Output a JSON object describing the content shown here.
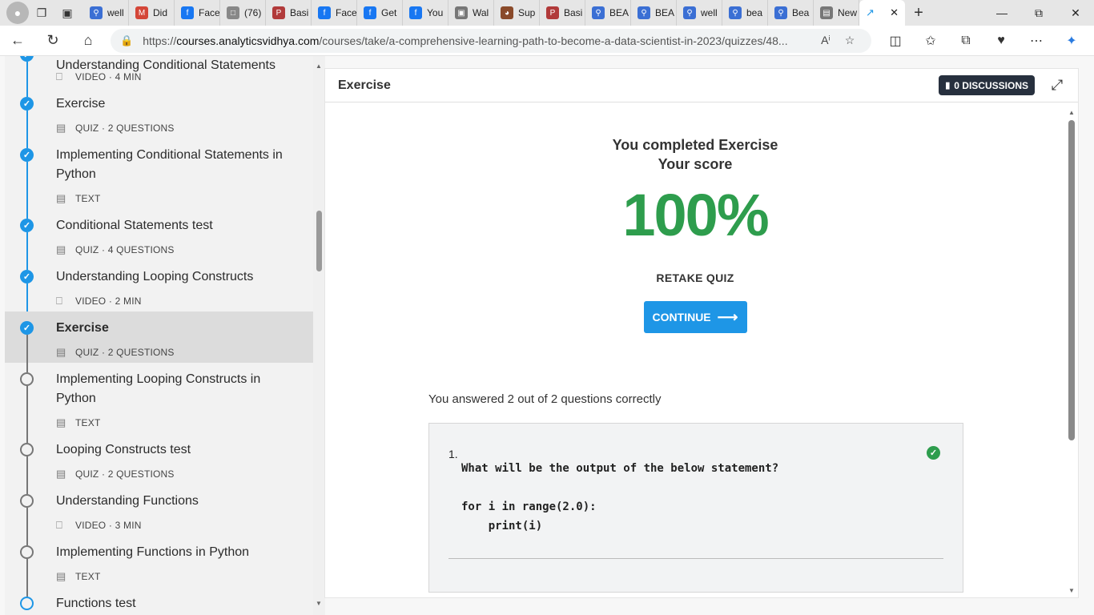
{
  "browser": {
    "tabs": [
      {
        "label": "well",
        "icon": "search-icon",
        "color": "#3b6fd4"
      },
      {
        "label": "Did",
        "icon": "gmail-icon",
        "color": "#d44638"
      },
      {
        "label": "Face",
        "icon": "facebook-icon",
        "color": "#1877f2"
      },
      {
        "label": "(76)",
        "icon": "document-icon",
        "color": "#888888"
      },
      {
        "label": "Basi",
        "icon": "pdf-icon",
        "color": "#b13a3a"
      },
      {
        "label": "Face",
        "icon": "facebook-icon",
        "color": "#1877f2"
      },
      {
        "label": "Get",
        "icon": "facebook-icon",
        "color": "#1877f2"
      },
      {
        "label": "You",
        "icon": "facebook-icon",
        "color": "#1877f2"
      },
      {
        "label": "Wal",
        "icon": "wallet-icon",
        "color": "#777777"
      },
      {
        "label": "Sup",
        "icon": "brand-icon",
        "color": "#8a4a2a"
      },
      {
        "label": "Basi",
        "icon": "pdf-icon",
        "color": "#b13a3a"
      },
      {
        "label": "BEA",
        "icon": "search-icon",
        "color": "#3b6fd4"
      },
      {
        "label": "BEA",
        "icon": "search-icon",
        "color": "#3b6fd4"
      },
      {
        "label": "well",
        "icon": "search-icon",
        "color": "#3b6fd4"
      },
      {
        "label": "bea",
        "icon": "search-icon",
        "color": "#3b6fd4"
      },
      {
        "label": "Bea",
        "icon": "search-icon",
        "color": "#3b6fd4"
      },
      {
        "label": "New",
        "icon": "newtab-icon",
        "color": "#777777"
      }
    ],
    "active_tab_icon": "analytics-icon",
    "url_prefix": "https://",
    "url_host": "courses.analyticsvidhya.com",
    "url_path": "/courses/take/a-comprehensive-learning-path-to-become-a-data-scientist-in-2023/quizzes/48..."
  },
  "sidebar": {
    "items": [
      {
        "title": "Understanding Conditional Statements",
        "meta": "VIDEO · 4 MIN",
        "type": "video",
        "status": "done"
      },
      {
        "title": "Exercise",
        "meta": "QUIZ · 2 QUESTIONS",
        "type": "quiz",
        "status": "done"
      },
      {
        "title": "Implementing Conditional Statements in Python",
        "meta": "TEXT",
        "type": "text",
        "status": "done"
      },
      {
        "title": "Conditional Statements test",
        "meta": "QUIZ · 4 QUESTIONS",
        "type": "quiz",
        "status": "done"
      },
      {
        "title": "Understanding Looping Constructs",
        "meta": "VIDEO · 2 MIN",
        "type": "video",
        "status": "done"
      },
      {
        "title": "Exercise",
        "meta": "QUIZ · 2 QUESTIONS",
        "type": "quiz",
        "status": "done"
      },
      {
        "title": "Implementing Looping Constructs in Python",
        "meta": "TEXT",
        "type": "text",
        "status": "todo"
      },
      {
        "title": "Looping Constructs test",
        "meta": "QUIZ · 2 QUESTIONS",
        "type": "quiz",
        "status": "todo"
      },
      {
        "title": "Understanding Functions",
        "meta": "VIDEO · 3 MIN",
        "type": "video",
        "status": "todo"
      },
      {
        "title": "Implementing Functions in Python",
        "meta": "TEXT",
        "type": "text",
        "status": "todo"
      },
      {
        "title": "Functions test",
        "meta": "",
        "type": "quiz",
        "status": "todo"
      }
    ]
  },
  "main": {
    "title": "Exercise",
    "discussions_label": "0 DISCUSSIONS",
    "completed_text": "You completed Exercise",
    "score_label": "Your score",
    "score": "100%",
    "retake_label": "RETAKE QUIZ",
    "continue_label": "CONTINUE",
    "answered_text": "You answered 2 out of 2 questions correctly",
    "question": {
      "number": "1.",
      "text": "What will be the output of the below statement?\n\nfor i in range(2.0):\n    print(i)"
    },
    "colors": {
      "accent": "#1e96e6",
      "success": "#2e9d4d"
    }
  }
}
